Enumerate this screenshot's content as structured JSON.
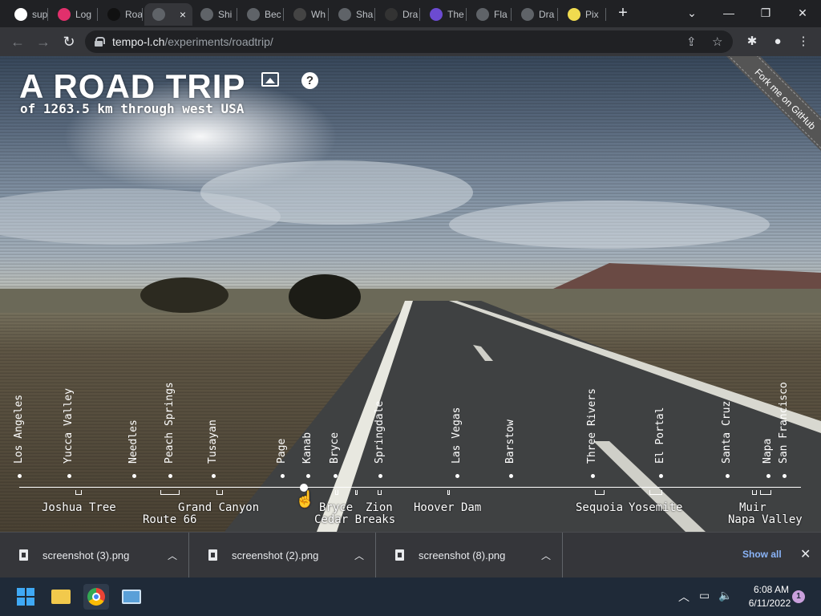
{
  "tabs": [
    {
      "label": "sup",
      "icon": "google-icon",
      "color": "#ffffff"
    },
    {
      "label": "Log",
      "icon": "instagram-icon",
      "color": "#e1306c"
    },
    {
      "label": "Roa",
      "icon": "e-icon",
      "color": "#111111"
    },
    {
      "label": "",
      "icon": "car-icon",
      "color": "#5f6368",
      "active": true,
      "close": "×"
    },
    {
      "label": "Shi",
      "icon": "globe-icon",
      "color": "#5f6368"
    },
    {
      "label": "Bec",
      "icon": "doc-icon",
      "color": "#5f6368"
    },
    {
      "label": "Wh",
      "icon": "w-icon",
      "color": "#444444"
    },
    {
      "label": "Sha",
      "icon": "dots-icon",
      "color": "#5f6368"
    },
    {
      "label": "Dra",
      "icon": "github-icon",
      "color": "#333333"
    },
    {
      "label": "The",
      "icon": "hexagon-icon",
      "color": "#6c4bd1"
    },
    {
      "label": "Fla",
      "icon": "globe-icon",
      "color": "#5f6368"
    },
    {
      "label": "Dra",
      "icon": "globe-icon",
      "color": "#5f6368"
    },
    {
      "label": "Pix",
      "icon": "js-icon",
      "color": "#f0db4f"
    }
  ],
  "browser": {
    "url_host": "tempo-l.ch",
    "url_path": "/experiments/roadtrip/"
  },
  "page": {
    "title": "A ROAD TRIP",
    "subtitle": "of 1263.5 km through west USA",
    "fork_ribbon": "Fork me on GitHub",
    "help": "?"
  },
  "stops": [
    "Los Angeles",
    "Yucca Valley",
    "Needles",
    "Peach Springs",
    "Tusayan",
    "Page",
    "Kanab",
    "Bryce",
    "Springdale",
    "Las Vegas",
    "Barstow",
    "Three Rivers",
    "El Portal",
    "Santa Cruz",
    "Napa",
    "San Francisco"
  ],
  "regions": [
    "Joshua Tree",
    "Route 66",
    "Grand Canyon",
    "Bryce",
    "Cedar Breaks",
    "Zion",
    "Hoover Dam",
    "Sequoia",
    "Yosemite",
    "Muir",
    "Napa Valley"
  ],
  "downloads": {
    "files": [
      "screenshot (3).png",
      "screenshot (2).png",
      "screenshot (8).png"
    ],
    "show_all": "Show all"
  },
  "taskbar": {
    "time": "6:08 AM",
    "date": "6/11/2022",
    "notifications": "1"
  },
  "colors": {
    "accent": "#8ab4f8",
    "tab_active": "#35363a",
    "tab_bg": "#202124"
  }
}
